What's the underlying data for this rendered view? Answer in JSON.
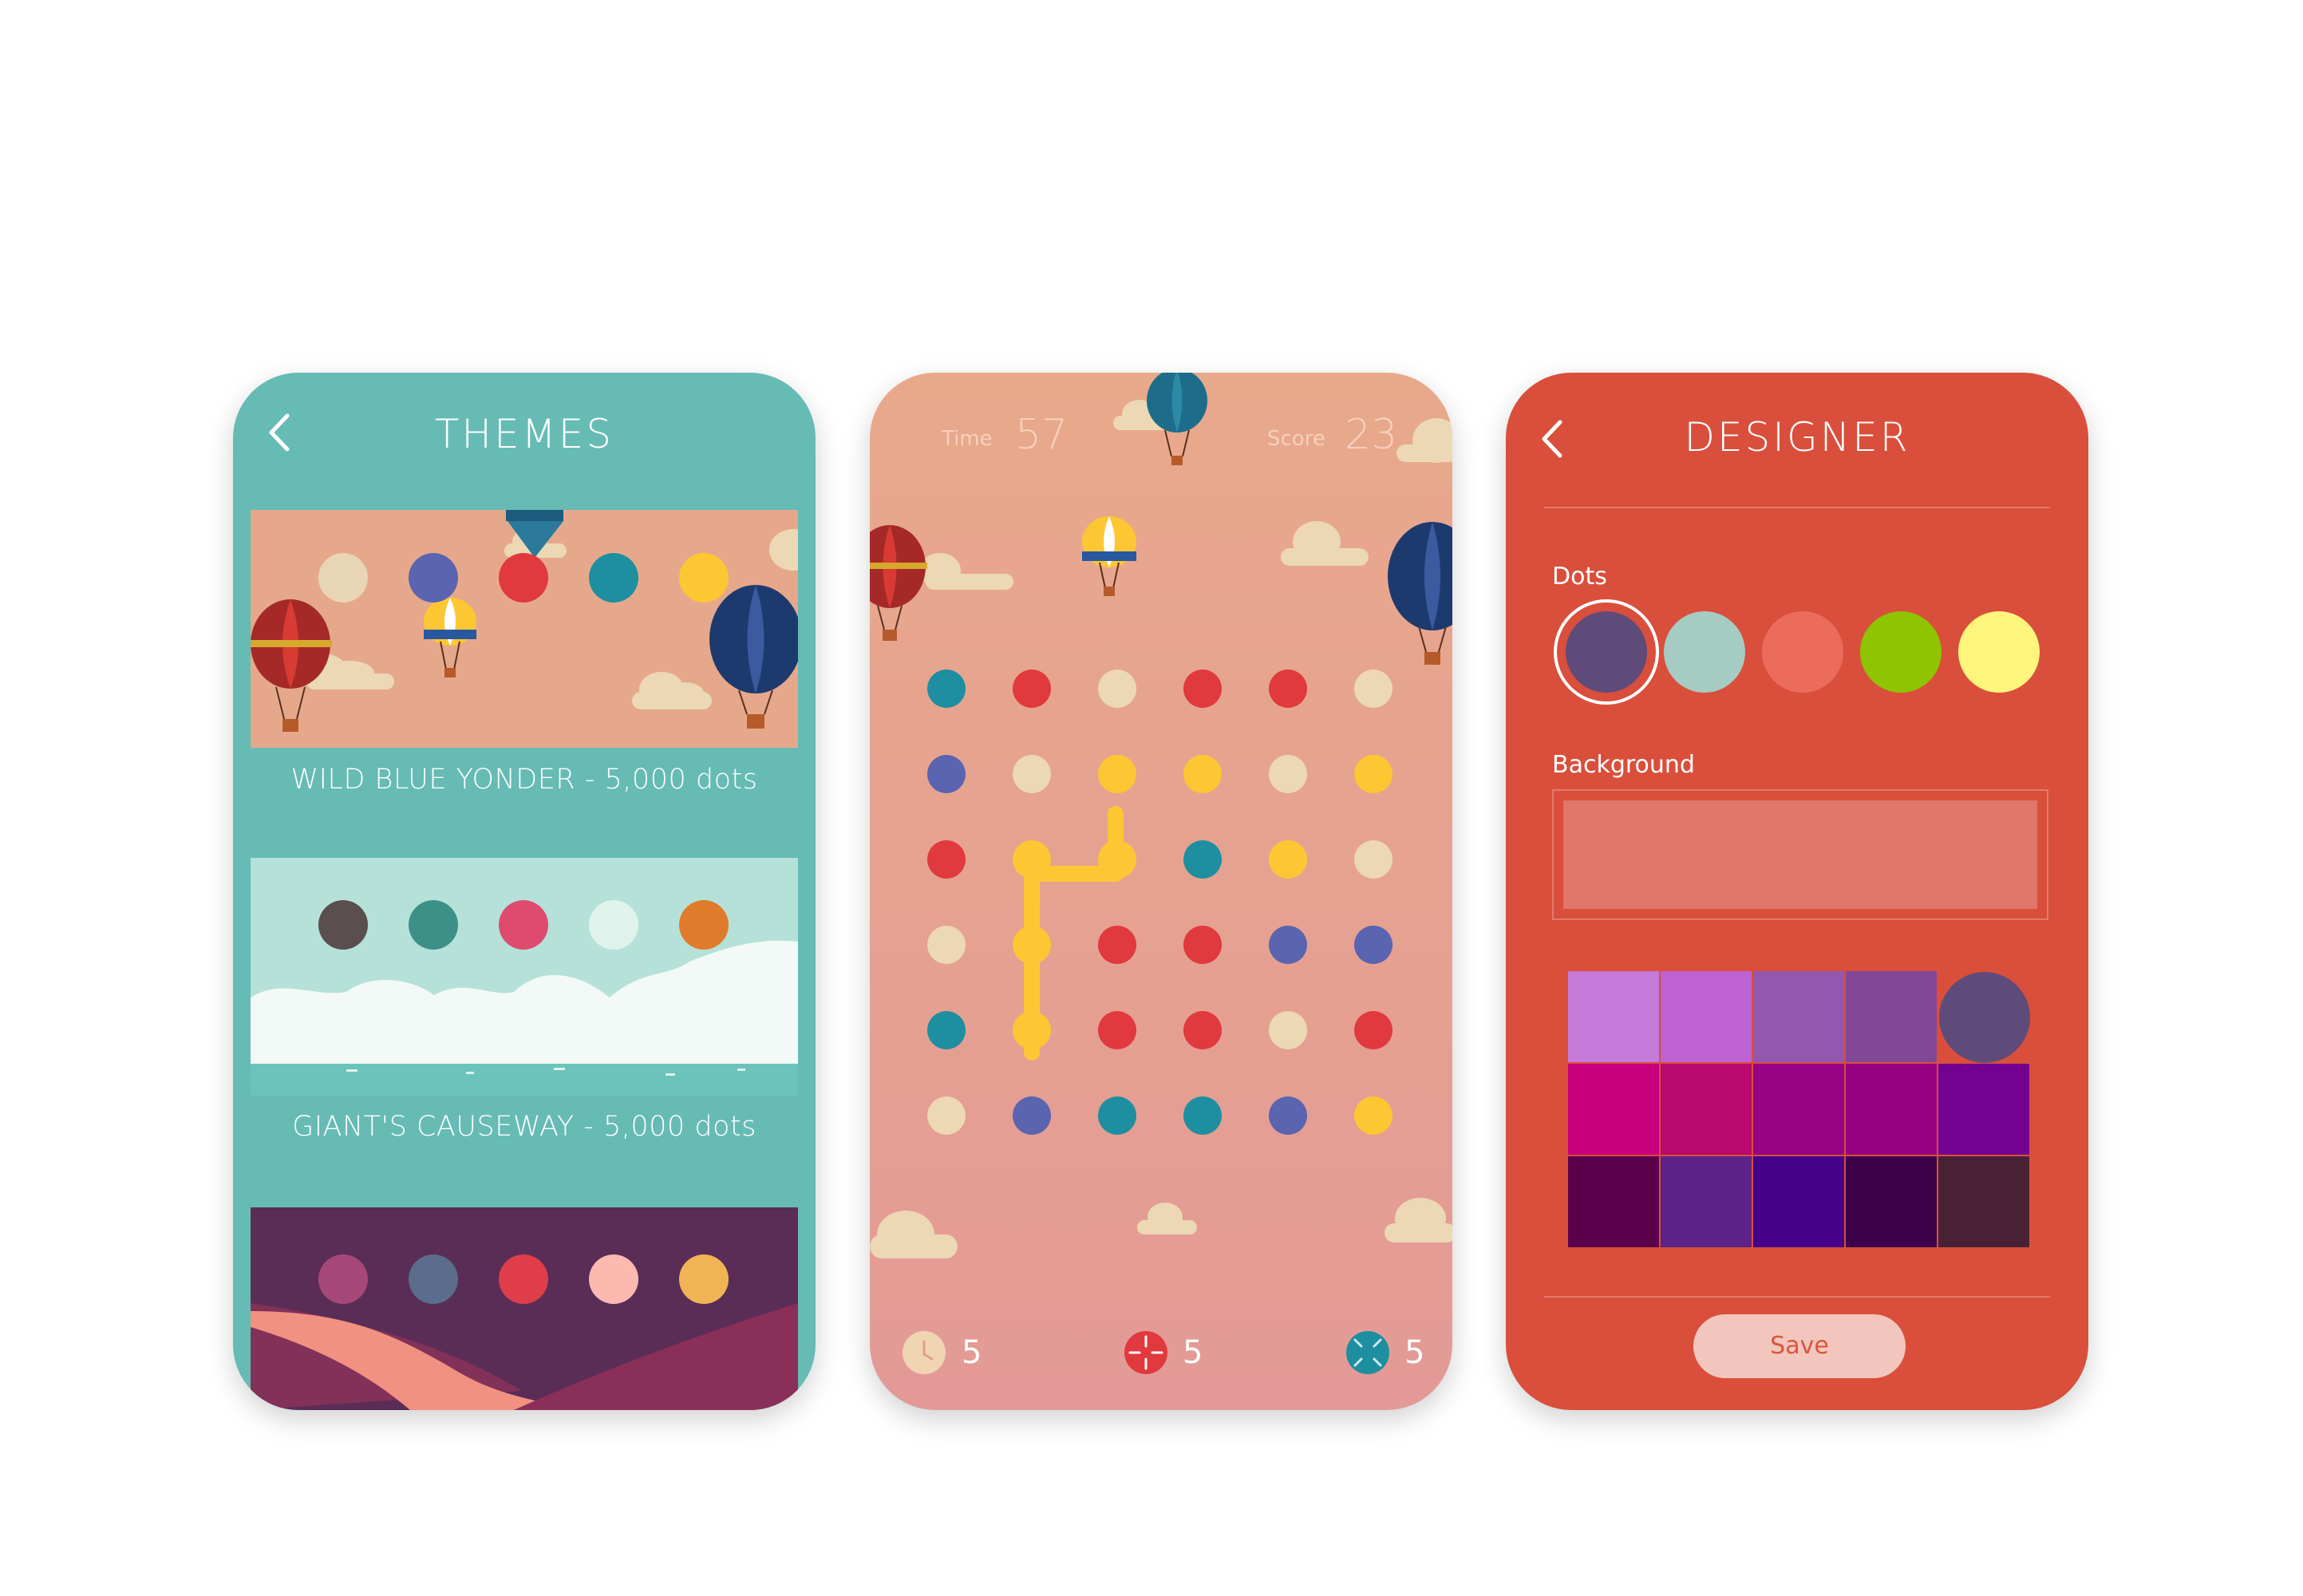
{
  "themes": {
    "title": "THEMES",
    "cards": [
      {
        "label": "WILD BLUE YONDER - 5,000 dots",
        "dots": [
          "#e8d5b5",
          "#5a64b0",
          "#e0393e",
          "#1d8fa0",
          "#fcc733"
        ]
      },
      {
        "label": "GIANT'S CAUSEWAY - 5,000 dots",
        "dots": [
          "#5a4f4e",
          "#3c9088",
          "#df4a6f",
          "#dff3ec",
          "#e07b2c"
        ]
      },
      {
        "label": "",
        "dots": [
          "#a6497a",
          "#5a6d8c",
          "#df3d4a",
          "#fbb9b0",
          "#f0b455"
        ]
      }
    ]
  },
  "game": {
    "time_label": "Time",
    "time_value": "57",
    "score_label": "Score",
    "score_value": "23",
    "grid": [
      [
        "#1d8fa0",
        "#e0393e",
        "#ecd8b4",
        "#e0393e",
        "#e0393e",
        "#ecd8b4"
      ],
      [
        "#5a64b0",
        "#ecd8b4",
        "#fcc733",
        "#fcc733",
        "#ecd8b4",
        "#fcc733"
      ],
      [
        "#e0393e",
        "#fcc733",
        "#fcc733",
        "#1d8fa0",
        "#fcc733",
        "#ecd8b4"
      ],
      [
        "#ecd8b4",
        "#fcc733",
        "#e0393e",
        "#e0393e",
        "#5a64b0",
        "#5a64b0"
      ],
      [
        "#1d8fa0",
        "#fcc733",
        "#e0393e",
        "#e0393e",
        "#ecd8b4",
        "#e0393e"
      ],
      [
        "#ecd8b4",
        "#5a64b0",
        "#1d8fa0",
        "#1d8fa0",
        "#5a64b0",
        "#fcc733"
      ]
    ],
    "powerups": [
      {
        "icon": "clock-icon",
        "count": "5",
        "color": "#f0d5b3"
      },
      {
        "icon": "shrink-icon",
        "count": "5",
        "color": "#e0393e"
      },
      {
        "icon": "expand-icon",
        "count": "5",
        "color": "#1d8fa0"
      }
    ]
  },
  "designer": {
    "title": "DESIGNER",
    "dots_label": "Dots",
    "dots": [
      "#5f4b7a",
      "#a5cbc3",
      "#ec6c5c",
      "#8ec400",
      "#fff57c"
    ],
    "background_label": "Background",
    "background_color": "#e0776a",
    "palette": [
      [
        "#c67ad9",
        "#be62d4",
        "#9357af",
        "#824796",
        "#5f4b7a"
      ],
      [
        "#c8007d",
        "#b90a6e",
        "#980285",
        "#960082",
        "#740290"
      ],
      [
        "#5b004a",
        "#5d2388",
        "#44018a",
        "#3d004b",
        "#482234"
      ]
    ],
    "save_label": "Save"
  }
}
